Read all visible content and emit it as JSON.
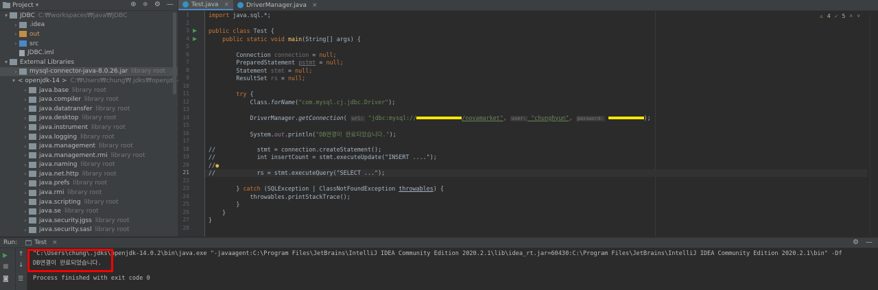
{
  "project": {
    "title": "Project",
    "tree": [
      {
        "label": "JDBC",
        "sub": "C:₩workspaces₩java₩JDBC",
        "kind": "module",
        "indent": 0,
        "expanded": true
      },
      {
        "label": ".idea",
        "kind": "folder",
        "indent": 1,
        "expanded": false
      },
      {
        "label": "out",
        "kind": "folder-orange",
        "indent": 1,
        "expanded": false,
        "orange": true
      },
      {
        "label": "src",
        "kind": "folder-blue",
        "indent": 1,
        "expanded": false
      },
      {
        "label": "JDBC.iml",
        "kind": "file",
        "indent": 1,
        "leaf": true
      },
      {
        "label": "External Libraries",
        "kind": "lib",
        "indent": 0,
        "expanded": true
      },
      {
        "label": "mysql-connector-java-8.0.26.jar",
        "sub": "library root",
        "kind": "jar",
        "indent": 1,
        "expanded": false,
        "selected": true
      },
      {
        "label": "< openjdk-14 >",
        "sub": "C:₩Users₩chung₩.jdks₩openjdk-14.0.2",
        "kind": "jdk",
        "indent": 1,
        "expanded": true
      },
      {
        "label": "java.base",
        "sub": "library root",
        "kind": "jar",
        "indent": 2
      },
      {
        "label": "java.compiler",
        "sub": "library root",
        "kind": "jar",
        "indent": 2
      },
      {
        "label": "java.datatransfer",
        "sub": "library root",
        "kind": "jar",
        "indent": 2
      },
      {
        "label": "java.desktop",
        "sub": "library root",
        "kind": "jar",
        "indent": 2
      },
      {
        "label": "java.instrument",
        "sub": "library root",
        "kind": "jar",
        "indent": 2
      },
      {
        "label": "java.logging",
        "sub": "library root",
        "kind": "jar",
        "indent": 2
      },
      {
        "label": "java.management",
        "sub": "library root",
        "kind": "jar",
        "indent": 2
      },
      {
        "label": "java.management.rmi",
        "sub": "library root",
        "kind": "jar",
        "indent": 2
      },
      {
        "label": "java.naming",
        "sub": "library root",
        "kind": "jar",
        "indent": 2
      },
      {
        "label": "java.net.http",
        "sub": "library root",
        "kind": "jar",
        "indent": 2
      },
      {
        "label": "java.prefs",
        "sub": "library root",
        "kind": "jar",
        "indent": 2
      },
      {
        "label": "java.rmi",
        "sub": "library root",
        "kind": "jar",
        "indent": 2
      },
      {
        "label": "java.scripting",
        "sub": "library root",
        "kind": "jar",
        "indent": 2
      },
      {
        "label": "java.se",
        "sub": "library root",
        "kind": "jar",
        "indent": 2
      },
      {
        "label": "java.security.jgss",
        "sub": "library root",
        "kind": "jar",
        "indent": 2
      },
      {
        "label": "java.security.sasl",
        "sub": "library root",
        "kind": "jar",
        "indent": 2
      }
    ]
  },
  "editor": {
    "tabs": [
      {
        "label": "Test.java",
        "active": true
      },
      {
        "label": "DriverManager.java",
        "active": false
      }
    ],
    "inspections": {
      "warnings": "4",
      "ok": "5"
    },
    "line_numbers": [
      "1",
      "2",
      "3",
      "4",
      "5",
      "6",
      "7",
      "8",
      "9",
      "10",
      "11",
      "12",
      "13",
      "14",
      "15",
      "16",
      "17",
      "18",
      "19",
      "20",
      "21",
      "22",
      "23",
      "24",
      "25",
      "26",
      "27",
      "28"
    ],
    "code": {
      "l1_kw": "import",
      "l1_rest": " java.sql.*;",
      "l3_kw": "public class",
      "l3_rest": " Test {",
      "l4_kw1": "public static void",
      "l4_fn": "main",
      "l4_rest": "(String[] args) {",
      "l6_type": "Connection ",
      "l6_var": "connection",
      "l6_eq": " = ",
      "l6_null": "null",
      "l6_end": ";",
      "l7_type": "PreparedStatement ",
      "l7_var": "pstmt",
      "l7_eq": " = ",
      "l7_null": "null",
      "l7_end": ";",
      "l8_type": "Statement ",
      "l8_var": "stmt",
      "l8_eq": " = ",
      "l8_null": "null",
      "l8_end": ";",
      "l9_type": "ResultSet ",
      "l9_var": "rs",
      "l9_eq": " = ",
      "l9_null": "null",
      "l9_end": ";",
      "l11_kw": "try",
      "l11_rest": " {",
      "l12_a": "Class.",
      "l12_fn": "forName",
      "l12_b": "(",
      "l12_str": "\"com.mysql.cj.jdbc.Driver\"",
      "l12_c": ");",
      "l14_a": "DriverManager.",
      "l14_fn": "getConnection",
      "l14_b": "( ",
      "l14_hint_url": "url:",
      "l14_str1": " \"jdbc:mysql://",
      "l14_str2": "/novamarket\"",
      "l14_sep1": ", ",
      "l14_hint_user": "user:",
      "l14_str3": " \"chunghyun\"",
      "l14_sep2": ", ",
      "l14_hint_pw": "password:",
      "l14_end": ");",
      "l16_a": "System.",
      "l16_out": "out",
      "l16_b": ".println(",
      "l16_str": "\"DB연결이 완료되었습니다.\"",
      "l16_c": ");",
      "l18_cm": "//",
      "l18_code": "            stmt = connection.createStatement();",
      "l19_cm": "//",
      "l19_code": "            int insertCount = stmt.executeUpdate(\"INSERT ....\");",
      "l20_cm": "//",
      "l21_cm": "//",
      "l21_code": "            rs = stmt.executeQuery(\"SELECT ...\");",
      "l23_a": "} ",
      "l23_kw": "catch",
      "l23_b": " (SQLException | ClassNotFoundException ",
      "l23_var": "throwables",
      "l23_c": ") {",
      "l24": "throwables.printStackTrace();",
      "l25": "}",
      "l26": "}",
      "l27": "}"
    }
  },
  "run": {
    "label": "Run:",
    "tab": "Test",
    "console": [
      "\"C:\\Users\\chung\\.jdks\\openjdk-14.0.2\\bin\\java.exe \"-javaagent:C:\\Program Files\\JetBrains\\IntelliJ IDEA Community Edition 2020.2.1\\lib\\idea_rt.jar=60430:C:\\Program Files\\JetBrains\\IntelliJ IDEA Community Edition 2020.2.1\\bin\" -Df",
      "DB연결이 완료되었습니다.",
      "",
      "Process finished with exit code 0"
    ]
  }
}
